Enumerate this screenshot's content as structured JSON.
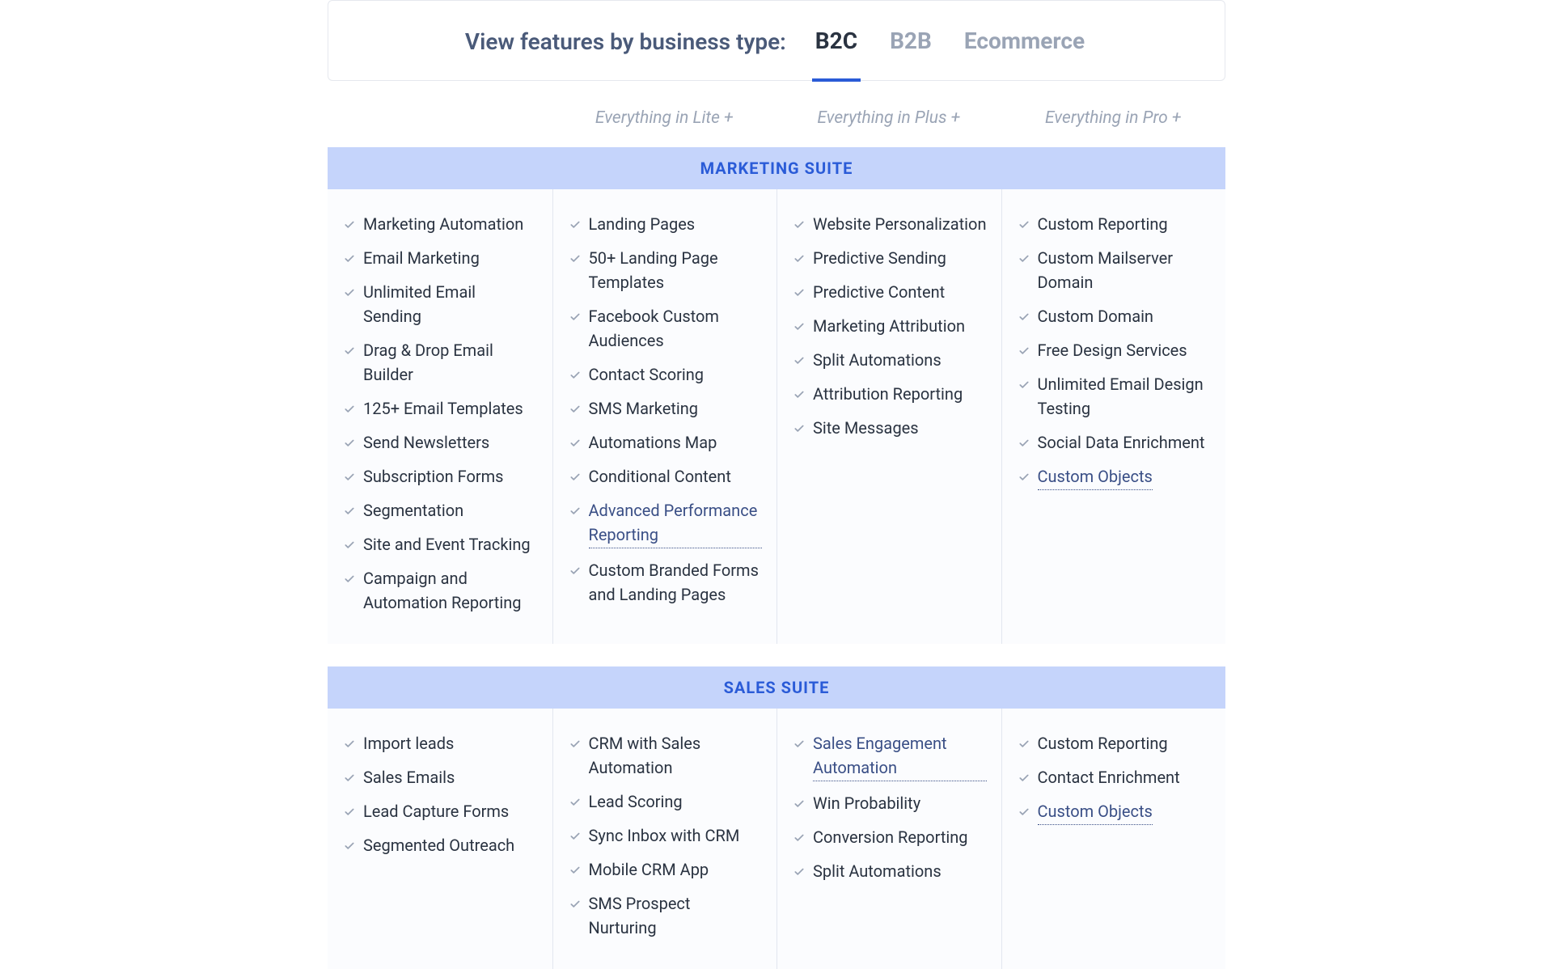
{
  "header": {
    "label": "View features by business type:",
    "tabs": [
      {
        "label": "B2C",
        "active": true
      },
      {
        "label": "B2B",
        "active": false
      },
      {
        "label": "Ecommerce",
        "active": false
      }
    ]
  },
  "tiers": {
    "col1": "",
    "col2": "Everything in Lite +",
    "col3": "Everything in Plus +",
    "col4": "Everything in Pro +"
  },
  "marketing": {
    "title": "MARKETING SUITE",
    "cols": [
      [
        {
          "label": "Marketing Automation"
        },
        {
          "label": "Email Marketing"
        },
        {
          "label": "Unlimited Email Sending"
        },
        {
          "label": "Drag & Drop Email Builder"
        },
        {
          "label": "125+ Email Templates"
        },
        {
          "label": "Send Newsletters"
        },
        {
          "label": "Subscription Forms"
        },
        {
          "label": "Segmentation"
        },
        {
          "label": "Site and Event Tracking"
        },
        {
          "label": "Campaign and Automation Reporting"
        }
      ],
      [
        {
          "label": "Landing Pages"
        },
        {
          "label": "50+ Landing Page Templates"
        },
        {
          "label": "Facebook Custom Audiences"
        },
        {
          "label": "Contact Scoring"
        },
        {
          "label": "SMS Marketing"
        },
        {
          "label": "Automations Map"
        },
        {
          "label": "Conditional Content"
        },
        {
          "label": "Advanced Performance Reporting",
          "link": true
        },
        {
          "label": "Custom Branded Forms and Landing Pages"
        }
      ],
      [
        {
          "label": "Website Personalization"
        },
        {
          "label": "Predictive Sending"
        },
        {
          "label": "Predictive Content"
        },
        {
          "label": "Marketing Attribution"
        },
        {
          "label": "Split Automations"
        },
        {
          "label": "Attribution Reporting"
        },
        {
          "label": "Site Messages"
        }
      ],
      [
        {
          "label": "Custom Reporting"
        },
        {
          "label": "Custom Mailserver Domain"
        },
        {
          "label": "Custom Domain"
        },
        {
          "label": "Free Design Services"
        },
        {
          "label": "Unlimited Email Design Testing"
        },
        {
          "label": "Social Data Enrichment"
        },
        {
          "label": "Custom Objects",
          "link": true
        }
      ]
    ]
  },
  "sales": {
    "title": "SALES SUITE",
    "cols": [
      [
        {
          "label": "Import leads"
        },
        {
          "label": "Sales Emails"
        },
        {
          "label": "Lead Capture Forms"
        },
        {
          "label": "Segmented Outreach"
        }
      ],
      [
        {
          "label": "CRM with Sales Automation"
        },
        {
          "label": "Lead Scoring"
        },
        {
          "label": "Sync Inbox with CRM"
        },
        {
          "label": "Mobile CRM App"
        },
        {
          "label": "SMS Prospect Nurturing"
        }
      ],
      [
        {
          "label": "Sales Engagement Automation",
          "link": true
        },
        {
          "label": "Win Probability"
        },
        {
          "label": "Conversion Reporting"
        },
        {
          "label": "Split Automations"
        }
      ],
      [
        {
          "label": "Custom Reporting"
        },
        {
          "label": "Contact Enrichment"
        },
        {
          "label": "Custom Objects",
          "link": true
        }
      ]
    ]
  }
}
